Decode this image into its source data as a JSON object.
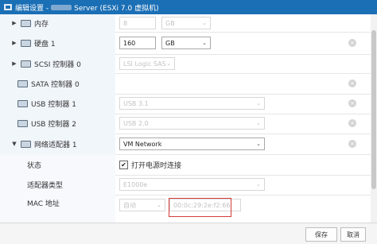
{
  "titlebar": {
    "prefix": "编辑设置 -",
    "suffix": "Server (ESXi 7.0 虚拟机)"
  },
  "rows": {
    "memory": {
      "label": "内存",
      "value": "8",
      "unit": "GB"
    },
    "disk": {
      "label": "硬盘 1",
      "value": "160",
      "unit": "GB"
    },
    "scsi": {
      "label": "SCSI 控制器 0",
      "value": "LSI Logic SAS"
    },
    "sata": {
      "label": "SATA 控制器 0"
    },
    "usb1": {
      "label": "USB 控制器 1",
      "value": "USB 3.1"
    },
    "usb2": {
      "label": "USB 控制器 2",
      "value": "USB 2.0"
    },
    "net": {
      "label": "网络适配器 1",
      "value": "VM Network"
    },
    "status": {
      "label": "状态",
      "checkbox_label": "打开电源时连接",
      "checked": true
    },
    "adapter": {
      "label": "适配器类型",
      "value": "E1000e"
    },
    "mac": {
      "label": "MAC 地址",
      "mode": "自动",
      "value": "00:0c:29:2e:f2:66"
    }
  },
  "footer": {
    "save": "保存",
    "cancel": "取消"
  },
  "icons": {
    "close": "×",
    "check": "✔",
    "arrow_right": "▶",
    "arrow_down": "▼",
    "chevron": "⌄"
  }
}
